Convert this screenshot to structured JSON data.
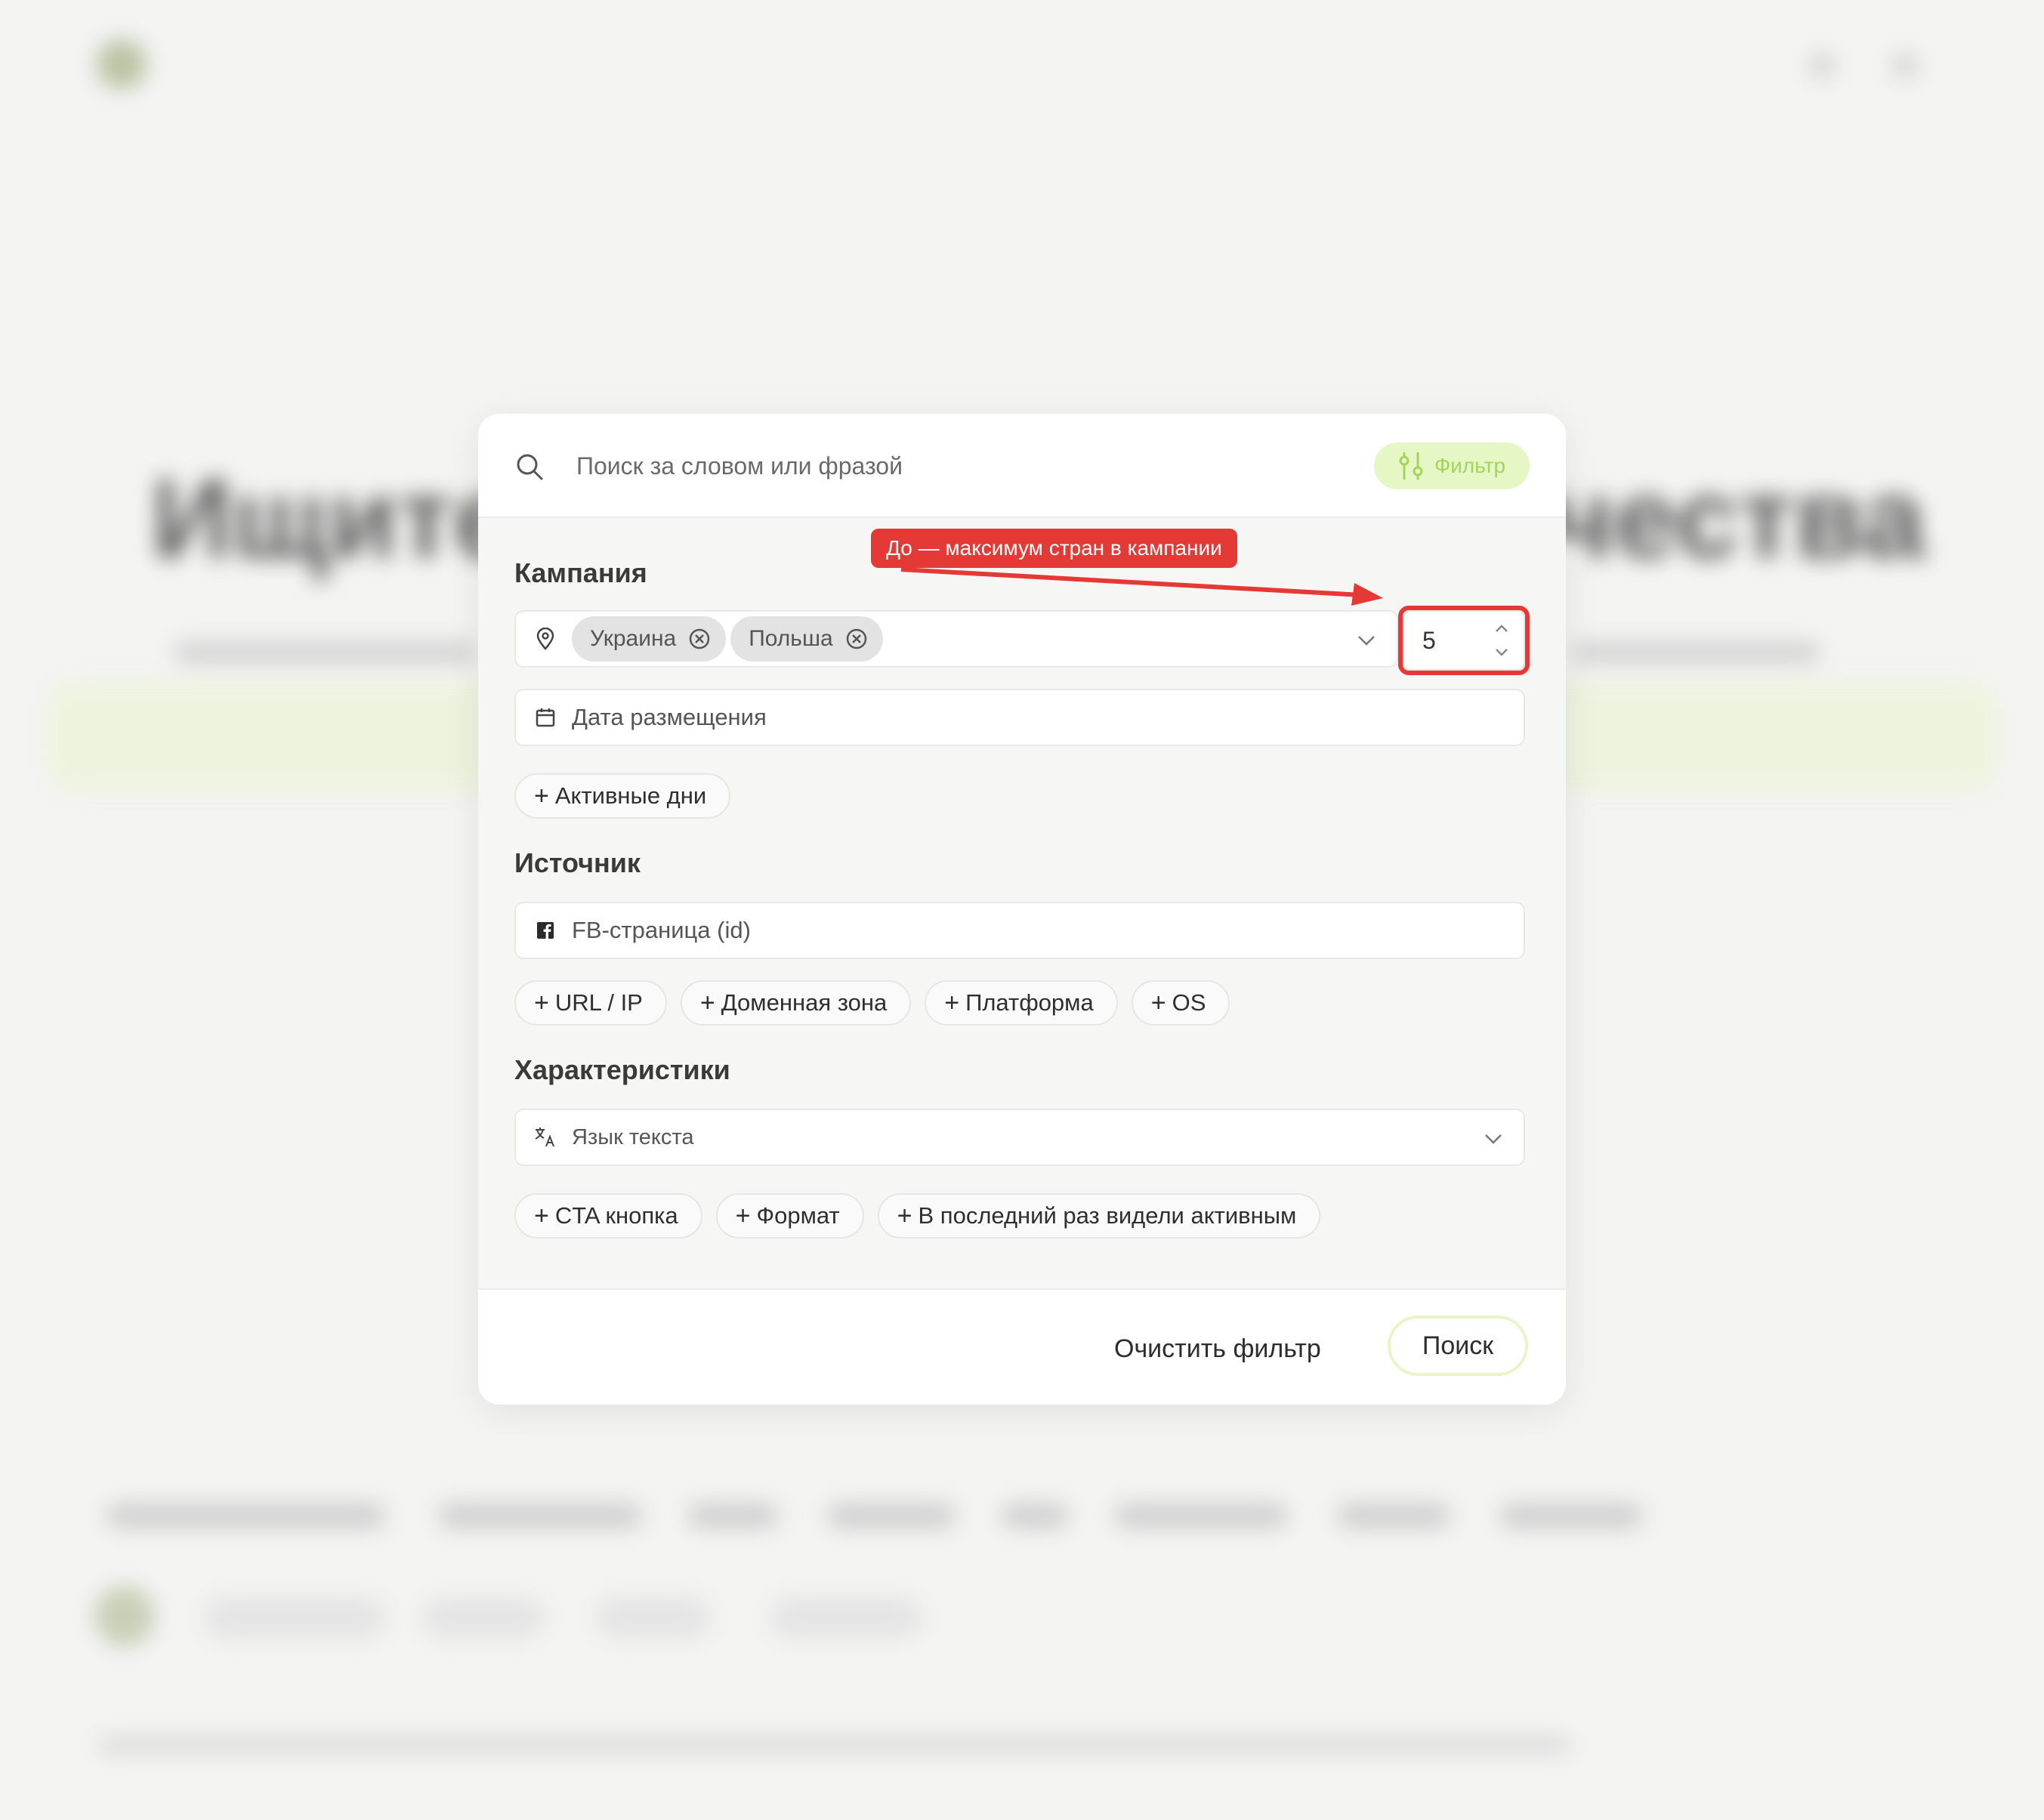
{
  "background": {
    "logo_text": "",
    "hero_left": "Ищите",
    "hero_right": "чества"
  },
  "search": {
    "placeholder": "Поиск за словом или фразой",
    "filter_label": "Фильтр"
  },
  "annotation": {
    "label": "До — максимум стран в кампании",
    "color": "#e53935"
  },
  "campaign": {
    "title": "Кампания",
    "countries": [
      {
        "label": "Украина"
      },
      {
        "label": "Польша"
      }
    ],
    "max_countries": "5",
    "date_placeholder": "Дата размещения",
    "active_days_label": "Активные дни"
  },
  "source": {
    "title": "Источник",
    "fb_placeholder": "FB-страница (id)",
    "pills": [
      "URL / IP",
      "Доменная зона",
      "Платформа",
      "OS"
    ]
  },
  "characteristics": {
    "title": "Характеристики",
    "language_placeholder": "Язык текста",
    "pills": [
      "CTA кнопка",
      "Формат",
      "В последний раз видели активным"
    ]
  },
  "footer": {
    "clear_label": "Очистить фильтр",
    "search_label": "Поиск"
  },
  "colors": {
    "accent_green": "#a4d45c",
    "accent_green_bg": "#e5f7c4"
  }
}
